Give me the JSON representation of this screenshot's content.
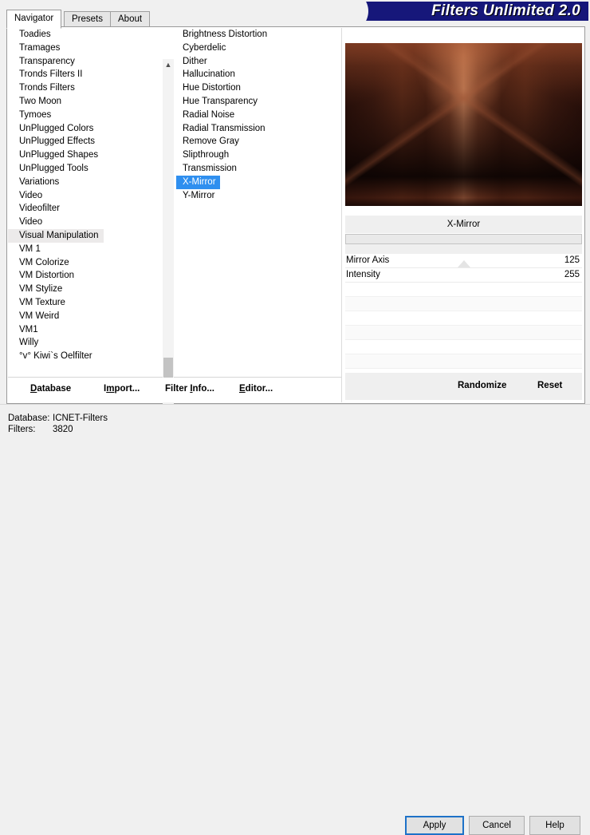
{
  "window": {
    "banner_title": "Filters Unlimited 2.0",
    "banner_bg": "#16177a",
    "banner_fg": "#ffffff"
  },
  "tabs": [
    {
      "label": "Navigator",
      "active": true
    },
    {
      "label": "Presets",
      "active": false
    },
    {
      "label": "About",
      "active": false
    }
  ],
  "category_list": {
    "selected": "Visual Manipulation",
    "selection_bg": "#eceaea",
    "items": [
      "Toadies",
      "Tramages",
      "Transparency",
      "Tronds Filters II",
      "Tronds Filters",
      "Two Moon",
      "Tymoes",
      "UnPlugged Colors",
      "UnPlugged Effects",
      "UnPlugged Shapes",
      "UnPlugged Tools",
      "Variations",
      "Video",
      "Videofilter",
      "Video",
      "Visual Manipulation",
      "VM 1",
      "VM Colorize",
      "VM Distortion",
      "VM Stylize",
      "VM Texture",
      "VM Weird",
      "VM1",
      "Willy",
      "°v° Kiwi`s Oelfilter"
    ]
  },
  "filter_list": {
    "selected": "X-Mirror",
    "selection_bg": "#2f8fef",
    "items": [
      "Brightness Distortion",
      "Cyberdelic",
      "Dither",
      "Hallucination",
      "Hue Distortion",
      "Hue Transparency",
      "Radial Noise",
      "Radial Transmission",
      "Remove Gray",
      "Slipthrough",
      "Transmission",
      "X-Mirror",
      "Y-Mirror"
    ]
  },
  "scrollbar": {
    "up_glyph": "▲",
    "down_glyph": "▼"
  },
  "commands": [
    {
      "label": "Database",
      "pre": "",
      "key": "D",
      "post": "atabase"
    },
    {
      "label": "Import...",
      "pre": "I",
      "key": "m",
      "post": "port..."
    },
    {
      "label": "Filter Info...",
      "pre": "Filter ",
      "key": "I",
      "post": "nfo..."
    },
    {
      "label": "Editor...",
      "pre": "",
      "key": "E",
      "post": "ditor..."
    }
  ],
  "preview": {
    "alt": "filter-preview-thumbnail",
    "base_color": "#140705",
    "highlight_color": "#9a4a2d"
  },
  "parameters": {
    "title": "X-Mirror",
    "rows": [
      {
        "label": "Mirror Axis",
        "value": "125",
        "has_marker": true
      },
      {
        "label": "Intensity",
        "value": "255",
        "has_marker": false
      }
    ]
  },
  "param_buttons": [
    {
      "label": "Randomize"
    },
    {
      "label": "Reset"
    }
  ],
  "status": {
    "database_label": "Database:",
    "database_value": "ICNET-Filters",
    "filters_label": "Filters:",
    "filters_value": "3820"
  },
  "dialog_buttons": [
    {
      "label": "Apply",
      "default": true
    },
    {
      "label": "Cancel",
      "default": false
    },
    {
      "label": "Help",
      "default": false
    }
  ]
}
